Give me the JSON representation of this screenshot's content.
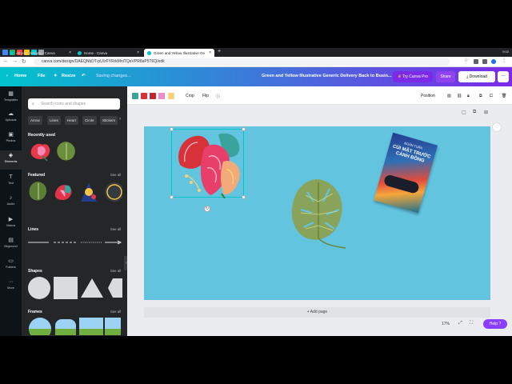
{
  "browser": {
    "tabs": [
      {
        "title": "All your designs - Canva"
      },
      {
        "title": "Home - Canva"
      },
      {
        "title": "Green and Yellow Illustrative Ge"
      }
    ],
    "new_tab": "+",
    "url": "canva.com/design/DAEQNbDT-pU/zFYRrkMnlTQeVPR8aP5T6Q/edit",
    "time": "9:02"
  },
  "header": {
    "home": "Home",
    "file": "File",
    "resize": "Resize",
    "saving": "Saving changes...",
    "doc_title": "Green and Yellow Illustrative Generic Delivery Back to Busin...",
    "try_canva_pro": "Try Canva Pro",
    "share": "Share",
    "download": "Download",
    "more": "..."
  },
  "rail": {
    "items": [
      {
        "label": "Templates",
        "icon": "templates-icon"
      },
      {
        "label": "Uploads",
        "icon": "upload-icon"
      },
      {
        "label": "Photos",
        "icon": "photos-icon"
      },
      {
        "label": "Elements",
        "icon": "elements-icon"
      },
      {
        "label": "Text",
        "icon": "text-icon"
      },
      {
        "label": "Audio",
        "icon": "audio-icon"
      },
      {
        "label": "Videos",
        "icon": "videos-icon"
      },
      {
        "label": "Bkground",
        "icon": "background-icon"
      },
      {
        "label": "Folders",
        "icon": "folders-icon"
      },
      {
        "label": "More",
        "icon": "more-icon"
      }
    ]
  },
  "panel": {
    "search_placeholder": "Search icons and shapes",
    "chips": [
      "Arrow",
      "Lines",
      "Heart",
      "Circle",
      "Stickers"
    ],
    "recently_used": "Recently used",
    "featured": "Featured",
    "lines": "Lines",
    "shapes": "Shapes",
    "frames": "Frames",
    "see_all": "See all"
  },
  "toolbar": {
    "colors": [
      "#3aa39b",
      "#d7323a",
      "#c8222d",
      "#f08acb",
      "#f7d27a"
    ],
    "crop": "Crop",
    "flip": "Flip",
    "position": "Position"
  },
  "canvas": {
    "page_color": "#62c4df",
    "book_title": "CÚI MẶT TRƯỚC CÁNH ĐỒNG",
    "book_author": "ĐOÀN TUẤN"
  },
  "footer": {
    "add_page": "+ Add page",
    "zoom": "17%",
    "help": "Help ?"
  },
  "colors": {
    "brand_gradient_start": "#00c4cc",
    "brand_gradient_end": "#7d2ae8",
    "accent": "#8b3dff"
  }
}
